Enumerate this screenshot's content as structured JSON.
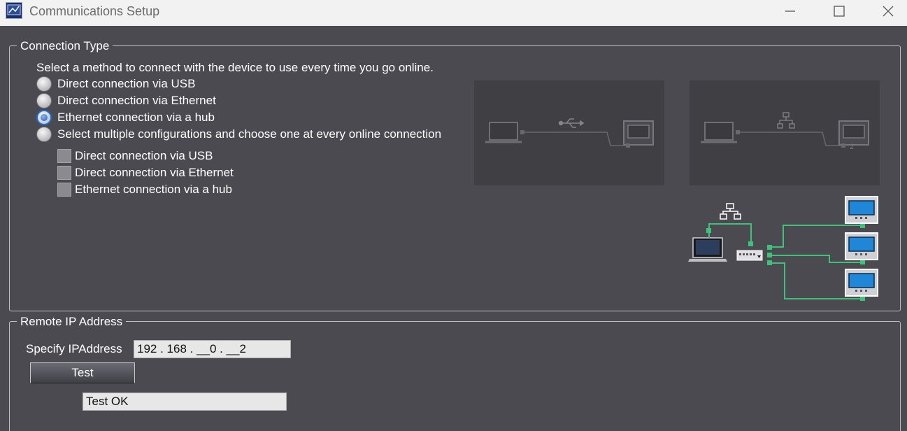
{
  "window": {
    "title": "Communications Setup",
    "controls": [
      "minimize-icon",
      "maximize-icon",
      "close-icon"
    ]
  },
  "connection_type": {
    "title": "Connection Type",
    "intro": "Select a method to connect with the device to use every time you go online.",
    "options": [
      {
        "label": "Direct connection via USB",
        "selected": false
      },
      {
        "label": "Direct connection via Ethernet",
        "selected": false
      },
      {
        "label": "Ethernet connection via a hub",
        "selected": true
      },
      {
        "label": "Select multiple configurations and choose one at every online connection",
        "selected": false
      }
    ],
    "sub_options": [
      {
        "label": "Direct connection via USB",
        "checked": false
      },
      {
        "label": "Direct connection via Ethernet",
        "checked": false
      },
      {
        "label": "Ethernet connection via a hub",
        "checked": false
      }
    ],
    "diagram_ethernet_port": "2",
    "colors": {
      "link": "#3ec27a",
      "screen": "#1f86d8"
    }
  },
  "remote_ip": {
    "title": "Remote IP Address",
    "label": "Specify IPAddress",
    "value": "192 . 168 . __0 . __2",
    "test_label": "Test",
    "result": "Test OK"
  }
}
